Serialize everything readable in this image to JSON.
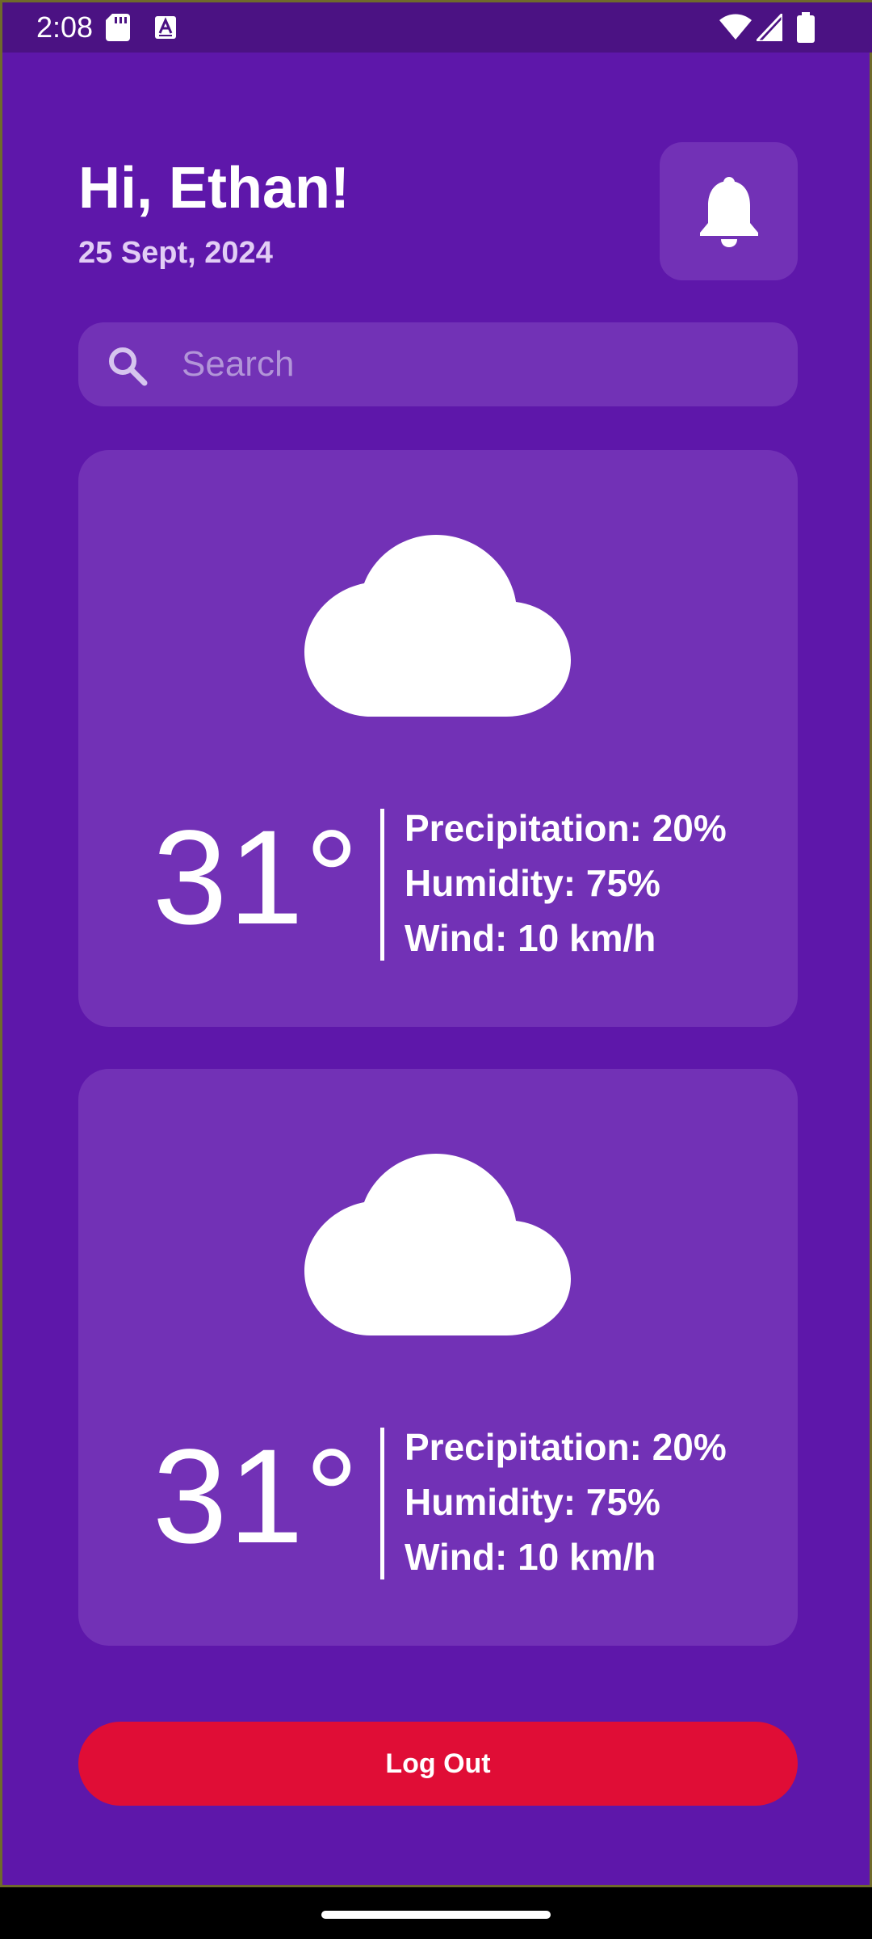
{
  "status_bar": {
    "time": "2:08",
    "left_icons": [
      "sd-card-icon",
      "keyboard-a-icon"
    ],
    "right_icons": [
      "wifi-icon",
      "signal-icon",
      "battery-icon"
    ]
  },
  "header": {
    "greeting": "Hi, Ethan!",
    "date": "25 Sept, 2024",
    "notification_icon": "bell-icon"
  },
  "search": {
    "placeholder": "Search",
    "value": "",
    "icon": "search-icon"
  },
  "weather_cards": [
    {
      "icon": "cloud-icon",
      "temperature": "31°",
      "precipitation": "Precipitation: 20%",
      "humidity": "Humidity: 75%",
      "wind": "Wind: 10 km/h"
    },
    {
      "icon": "cloud-icon",
      "temperature": "31°",
      "precipitation": "Precipitation: 20%",
      "humidity": "Humidity: 75%",
      "wind": "Wind: 10 km/h"
    }
  ],
  "logout": {
    "label": "Log Out",
    "color": "#e00d36"
  },
  "colors": {
    "background": "#5e17aa",
    "card": "#7231b6",
    "status_bar": "#4b1283",
    "accent_text": "#e2cdf5"
  }
}
